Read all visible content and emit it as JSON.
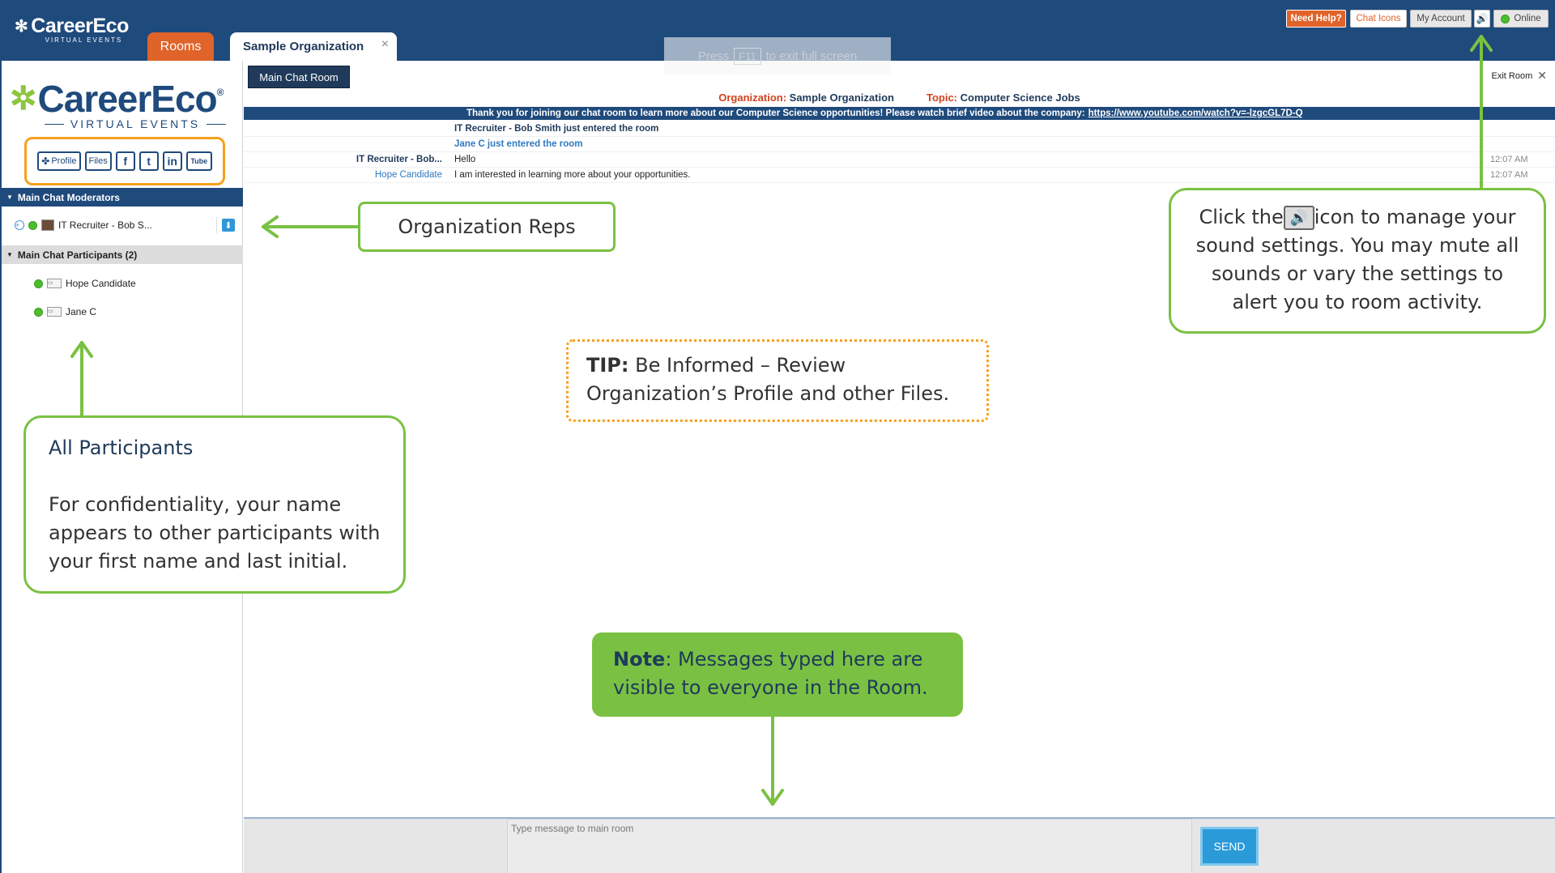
{
  "topbar": {
    "brand": "CareerEco",
    "brand_sub": "VIRTUAL EVENTS",
    "tab_rooms": "Rooms",
    "tab_org": "Sample Organization",
    "tab_close": "×",
    "fullscreen_prefix": "Press",
    "fullscreen_key": "F11",
    "fullscreen_suffix": "to exit full screen",
    "need_help": "Need Help?",
    "chat_icons": "Chat Icons",
    "my_account": "My Account",
    "online": "Online"
  },
  "sidebar": {
    "logo_brand": "CareerEco",
    "logo_sub": "VIRTUAL EVENTS",
    "social": {
      "profile": "Profile",
      "files": "Files",
      "facebook": "f",
      "twitter": "t",
      "linkedin": "in",
      "youtube": "Tube"
    },
    "moderators_header": "Main Chat Moderators",
    "moderators": [
      {
        "name": "IT Recruiter - Bob S..."
      }
    ],
    "participants_header": "Main Chat Participants (2)",
    "participants": [
      {
        "name": "Hope Candidate"
      },
      {
        "name": "Jane C"
      }
    ]
  },
  "main": {
    "room_tab": "Main Chat Room",
    "exit_room": "Exit Room",
    "org_label": "Organization:",
    "org_value": "Sample Organization",
    "topic_label": "Topic:",
    "topic_value": "Computer Science Jobs",
    "banner_text": "Thank you for joining our chat room to learn more about our Computer Science opportunities! Please watch brief video about the company:",
    "banner_link": "https://www.youtube.com/watch?v=-lzgcGL7D-Q",
    "messages": [
      {
        "who": "",
        "text": "IT Recruiter - Bob Smith just entered the room",
        "time": ""
      },
      {
        "who": "",
        "text": "Jane C just entered the room",
        "time": ""
      },
      {
        "who": "IT Recruiter - Bob...",
        "text": "Hello",
        "time": "12:07 AM"
      },
      {
        "who": "Hope Candidate",
        "text": "I am interested in learning more about your opportunities.",
        "time": "12:07 AM"
      }
    ],
    "input_placeholder": "Type message to main room",
    "send": "SEND"
  },
  "callouts": {
    "reps": "Organization Reps",
    "sound_pre": "Click the",
    "sound_post": "icon to manage your sound settings. You may mute all sounds or vary the settings to alert you to room activity.",
    "tip_bold": "TIP:",
    "tip_text": "Be Informed –  Review Organization’s Profile and other Files.",
    "part_title": "All Participants",
    "part_text": "For confidentiality, your name appears to other participants with your first name and last initial.",
    "note_bold": "Note",
    "note_text": ": Messages typed here are visible to everyone in the Room."
  },
  "colors": {
    "navy": "#1f4a7c",
    "orange": "#e0632a",
    "green": "#7ac143",
    "tip_border": "#f7a01d",
    "send_blue": "#2a9ad8"
  }
}
